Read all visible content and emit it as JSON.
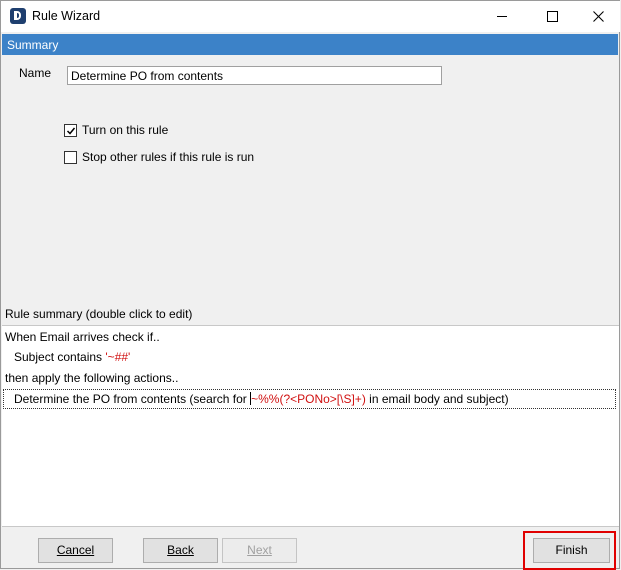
{
  "window": {
    "title": "Rule Wizard",
    "icons": {
      "app": "app-logo-icon",
      "minimize": "minimize-icon",
      "maximize": "maximize-icon",
      "close": "close-icon"
    }
  },
  "section": {
    "header": "Summary"
  },
  "form": {
    "name_label": "Name",
    "name_value": "Determine PO from contents",
    "turn_on": {
      "label": "Turn on this rule",
      "checked": true
    },
    "stop_other": {
      "label": "Stop other rules if this rule is run",
      "checked": false
    }
  },
  "rule_summary": {
    "label": "Rule summary (double click to edit)",
    "line1": "When Email arrives check if..",
    "line2_prefix": "Subject contains ",
    "line2_value": "'~##'",
    "line3": "then apply the following actions..",
    "line4_prefix": "Determine the PO from contents (search for ",
    "line4_value": "~%%(?<PONo>[\\S]+)",
    "line4_suffix": " in email body and subject)"
  },
  "buttons": {
    "cancel": "Cancel",
    "back": "Back",
    "next": "Next",
    "finish": "Finish"
  },
  "colors": {
    "header_bar": "#3c82c8",
    "highlight_value": "#d01010",
    "annotation_box": "#e00000"
  }
}
